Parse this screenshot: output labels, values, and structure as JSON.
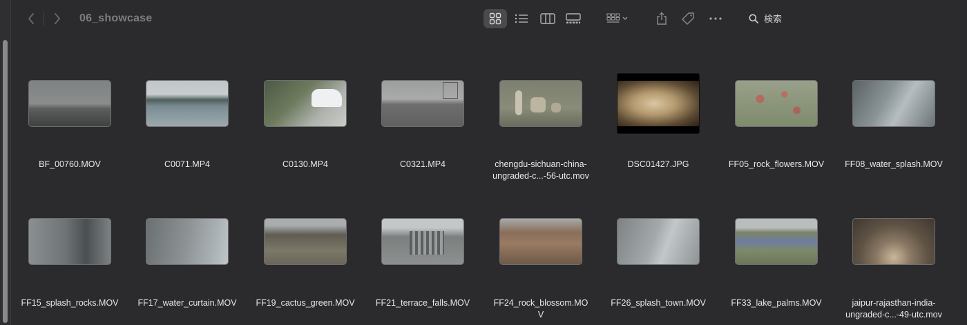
{
  "window": {
    "folder_title": "06_showcase"
  },
  "toolbar": {
    "back_icon": "chevron-left-icon",
    "forward_icon": "chevron-right-icon",
    "view_icons": [
      "grid-view-icon",
      "list-view-icon",
      "column-view-icon",
      "gallery-view-icon"
    ],
    "group_icon": "group-by-icon",
    "share_icon": "share-icon",
    "tag_icon": "tag-icon",
    "more_icon": "more-icon",
    "search_label": "検索"
  },
  "files": [
    {
      "name": "BF_00760.MOV"
    },
    {
      "name": "C0071.MP4"
    },
    {
      "name": "C0130.MP4"
    },
    {
      "name": "C0321.MP4"
    },
    {
      "name": "chengdu-sichuan-china-ungraded-c...-56-utc.mov",
      "line1": "chengdu-sichuan-china-",
      "line2": "ungraded-c...-56-utc.mov"
    },
    {
      "name": "DSC01427.JPG"
    },
    {
      "name": "FF05_rock_flowers.MOV"
    },
    {
      "name": "FF08_water_splash.MOV"
    },
    {
      "name": "FF15_splash_rocks.MOV"
    },
    {
      "name": "FF17_water_curtain.MOV"
    },
    {
      "name": "FF19_cactus_green.MOV"
    },
    {
      "name": "FF21_terrace_falls.MOV"
    },
    {
      "name": "FF24_rock_blossom.MOV",
      "line1": "FF24_rock_blossom.MO",
      "line2": "V"
    },
    {
      "name": "FF26_splash_town.MOV"
    },
    {
      "name": "FF33_lake_palms.MOV"
    },
    {
      "name": "jaipur-rajasthan-india-ungraded-c...-49-utc.mov",
      "line1": "jaipur-rajasthan-india-",
      "line2": "ungraded-c...-49-utc.mov"
    }
  ],
  "colors": {
    "background": "#2b2a2c",
    "selected_view": "#4a494c",
    "title": "#7d7c7f"
  }
}
